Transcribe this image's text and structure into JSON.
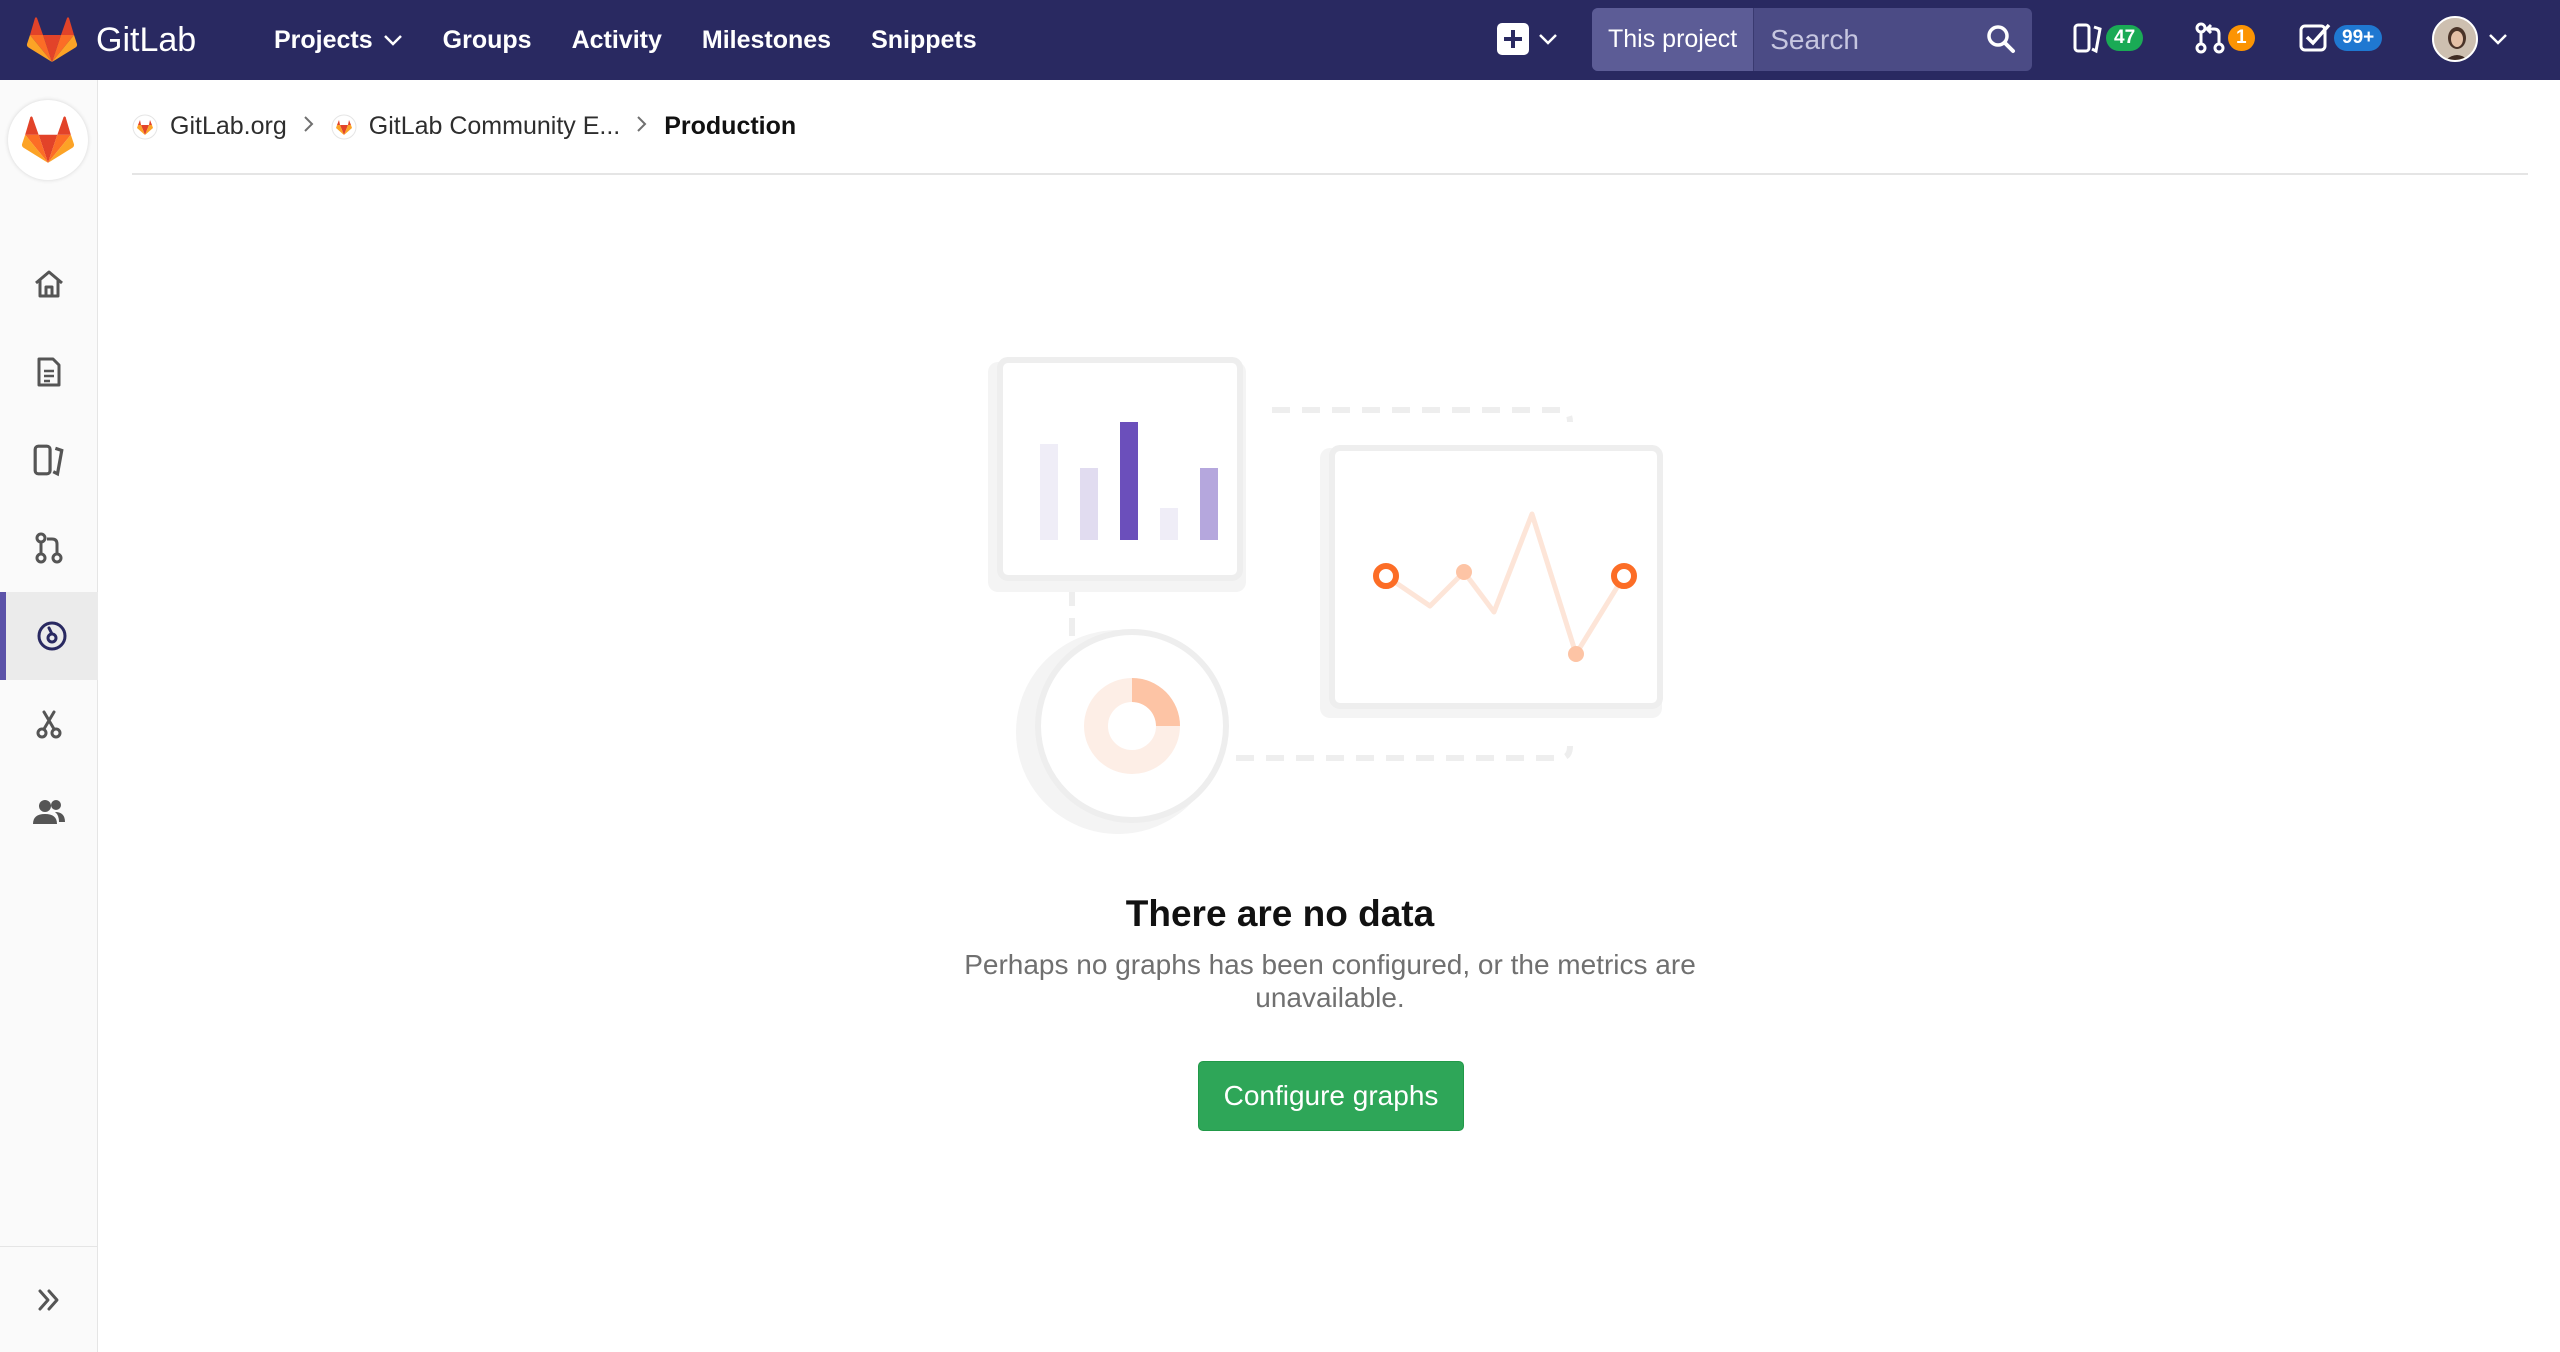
{
  "header": {
    "brand": "GitLab",
    "nav": [
      {
        "label": "Projects"
      },
      {
        "label": "Groups"
      },
      {
        "label": "Activity"
      },
      {
        "label": "Milestones"
      },
      {
        "label": "Snippets"
      }
    ],
    "search": {
      "scope": "This project",
      "placeholder": "Search"
    },
    "counters": {
      "issues": "47",
      "merge_requests": "1",
      "todos": "99+"
    }
  },
  "colors": {
    "header_bg": "#292961",
    "accent": "#5b52a8",
    "primary_button": "#2ea658",
    "issues_badge": "#1aaa55",
    "mr_badge": "#fc9403",
    "todos_badge": "#1f78d1"
  },
  "sidebar": {
    "items": [
      {
        "icon": "home-icon"
      },
      {
        "icon": "repository-icon"
      },
      {
        "icon": "issues-icon"
      },
      {
        "icon": "merge-request-icon"
      },
      {
        "icon": "operations-icon",
        "active": true
      },
      {
        "icon": "snippets-icon"
      },
      {
        "icon": "members-icon"
      }
    ],
    "collapse_icon": "double-chevron-right-icon"
  },
  "breadcrumb": [
    {
      "label": "GitLab.org"
    },
    {
      "label": "GitLab Community E..."
    },
    {
      "label": "Production"
    }
  ],
  "empty_state": {
    "title": "There are no data",
    "description": "Perhaps no graphs has been configured, or the metrics are unavailable.",
    "button": "Configure graphs"
  }
}
